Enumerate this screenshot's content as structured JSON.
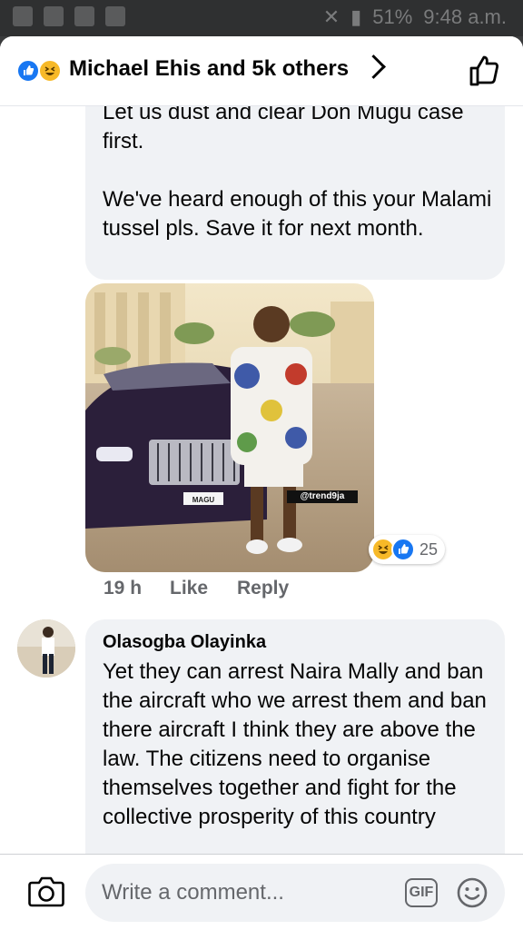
{
  "status_bar": {
    "battery": "51%",
    "time": "9:48 a.m."
  },
  "header": {
    "title": "Michael Ehis and 5k others"
  },
  "comment1": {
    "text": "Let us dust and clear Don Mugu case first.\n\nWe've heard enough of this your Malami tussel pls. Save it for next month.",
    "image_watermark": "@trend9ja",
    "plate_text": "MAGU",
    "reaction_count": "25",
    "time": "19 h",
    "like_label": "Like",
    "reply_label": "Reply"
  },
  "comment2": {
    "author": "Olasogba Olayinka",
    "text": "Yet they can arrest Naira Mally and ban the aircraft who we arrest them and ban there aircraft I think they are above the law. The citizens need to organise themselves together and fight for the collective prosperity of this country"
  },
  "composer": {
    "placeholder": "Write a comment...",
    "gif_label": "GIF"
  },
  "colors": {
    "accent": "#1877f2",
    "haha": "#f7b928",
    "bubble": "#f0f2f5",
    "secondary_text": "#65676b"
  }
}
